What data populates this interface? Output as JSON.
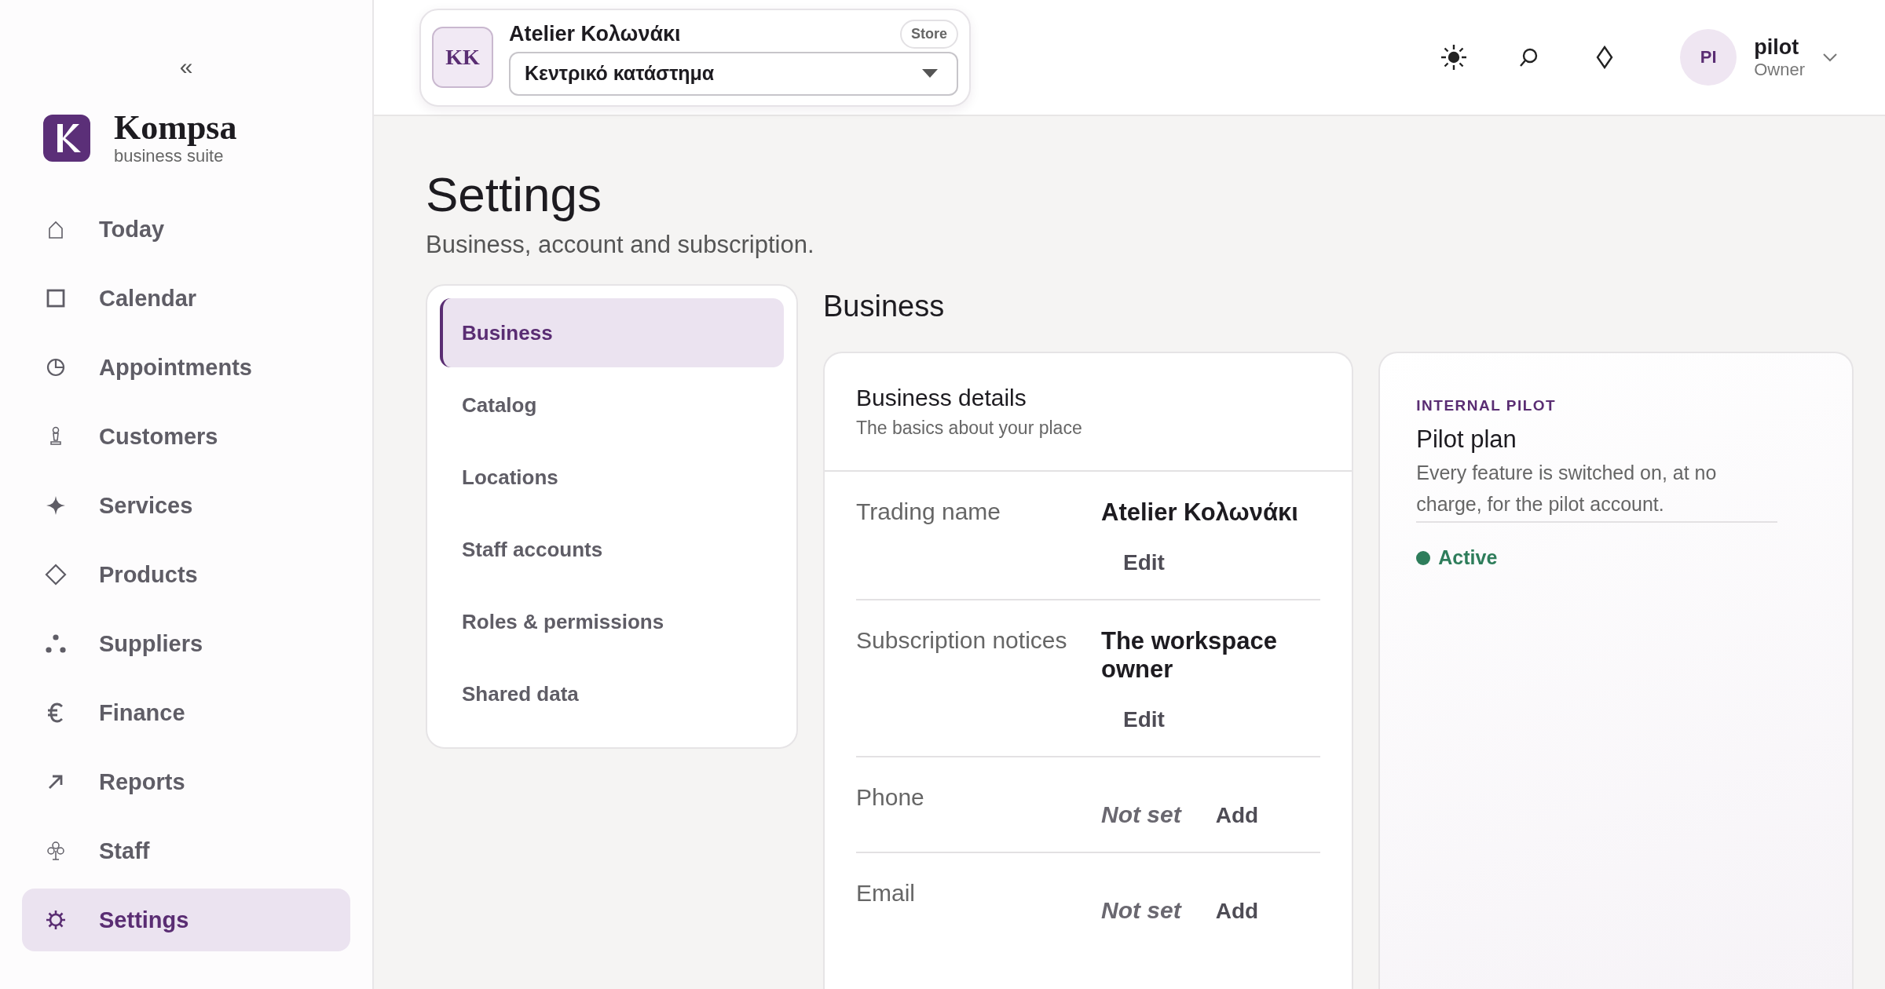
{
  "sidebar": {
    "collapse_glyph": "«",
    "brand": {
      "name": "Kompsa",
      "tagline": "business suite"
    },
    "items": [
      {
        "label": "Today",
        "kind": "home",
        "selected": false
      },
      {
        "label": "Calendar",
        "kind": "square",
        "selected": false
      },
      {
        "label": "Appointments",
        "kind": "clock",
        "selected": false
      },
      {
        "label": "Customers",
        "kind": "pawn",
        "selected": false
      },
      {
        "label": "Services",
        "kind": "sparkle",
        "selected": false
      },
      {
        "label": "Products",
        "kind": "diamond",
        "selected": false
      },
      {
        "label": "Suppliers",
        "kind": "dots",
        "selected": false
      },
      {
        "label": "Finance",
        "kind": "euro",
        "selected": false
      },
      {
        "label": "Reports",
        "kind": "arrow",
        "selected": false
      },
      {
        "label": "Staff",
        "kind": "club",
        "selected": false
      },
      {
        "label": "Settings",
        "kind": "gear",
        "selected": true
      }
    ]
  },
  "header": {
    "store": {
      "initials": "KK",
      "name": "Atelier Κολωνάκι",
      "badge": "Store",
      "location": "Κεντρικό κατάστημα"
    },
    "user": {
      "initials": "PI",
      "name": "pilot",
      "role": "Owner"
    }
  },
  "page": {
    "title": "Settings",
    "subtitle": "Business, account and subscription."
  },
  "settings_nav": [
    {
      "label": "Business",
      "selected": true
    },
    {
      "label": "Catalog",
      "selected": false
    },
    {
      "label": "Locations",
      "selected": false
    },
    {
      "label": "Staff accounts",
      "selected": false
    },
    {
      "label": "Roles & permissions",
      "selected": false
    },
    {
      "label": "Shared data",
      "selected": false
    }
  ],
  "section_title": "Business",
  "details": {
    "title": "Business details",
    "subtitle": "The basics about your place",
    "rows": [
      {
        "kind": "value",
        "label": "Trading name",
        "value": "Atelier Κολωνάκι",
        "action": "Edit"
      },
      {
        "kind": "value",
        "label": "Subscription notices",
        "value": "The workspace owner",
        "action": "Edit"
      },
      {
        "kind": "empty",
        "label": "Phone",
        "value": "Not set",
        "action": "Add"
      },
      {
        "kind": "empty",
        "label": "Email",
        "value": "Not set",
        "action": "Add"
      }
    ]
  },
  "plan": {
    "eyebrow": "INTERNAL PILOT",
    "title": "Pilot plan",
    "description": "Every feature is switched on, at no charge, for the pilot account.",
    "status": "Active"
  }
}
